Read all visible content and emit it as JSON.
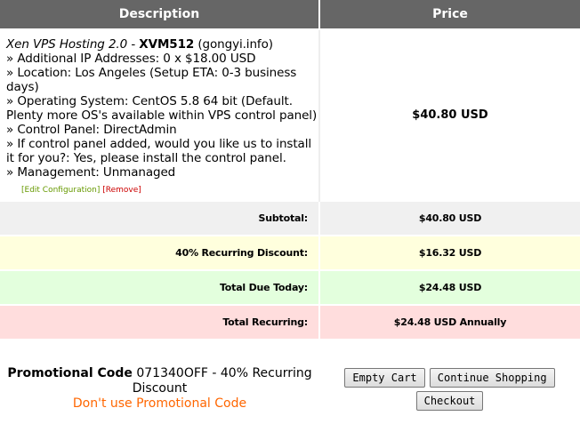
{
  "table": {
    "headers": {
      "description": "Description",
      "price": "Price"
    }
  },
  "item": {
    "product": "Xen VPS Hosting 2.0",
    "separator": " - ",
    "plan": "XVM512",
    "domain": "(gongyi.info)",
    "config": [
      "» Additional IP Addresses: 0 x $18.00 USD",
      "» Location: Los Angeles (Setup ETA: 0-3 business days)",
      "» Operating System: CentOS 5.8 64 bit (Default. Plenty more OS's available within VPS control panel)",
      "» Control Panel: DirectAdmin",
      "» If control panel added, would you like us to install it for you?: Yes, please install the control panel.",
      "» Management: Unmanaged"
    ],
    "price": "$40.80 USD",
    "edit_label": "[Edit Configuration]",
    "remove_label": "[Remove]"
  },
  "summary": {
    "subtotal_label": "Subtotal:",
    "subtotal_value": "$40.80 USD",
    "discount_label": "40% Recurring Discount:",
    "discount_value": "$16.32 USD",
    "due_today_label": "Total Due Today:",
    "due_today_value": "$24.48 USD",
    "recurring_label": "Total Recurring:",
    "recurring_value": "$24.48 USD Annually"
  },
  "promo": {
    "label": "Promotional Code",
    "text": " 071340OFF - 40% Recurring Discount",
    "remove_link": "Don't use Promotional Code"
  },
  "buttons": {
    "empty_cart": "Empty Cart",
    "continue_shopping": "Continue Shopping",
    "checkout": "Checkout"
  },
  "colors": {
    "header_bg": "#666666",
    "subtotal_bg": "#f0f0f0",
    "discount_bg": "#ffffdd",
    "due_today_bg": "#e3ffdd",
    "recurring_bg": "#ffdddd",
    "promo_link": "#ff6600",
    "edit_link": "#669900",
    "remove_link": "#cc0000"
  }
}
